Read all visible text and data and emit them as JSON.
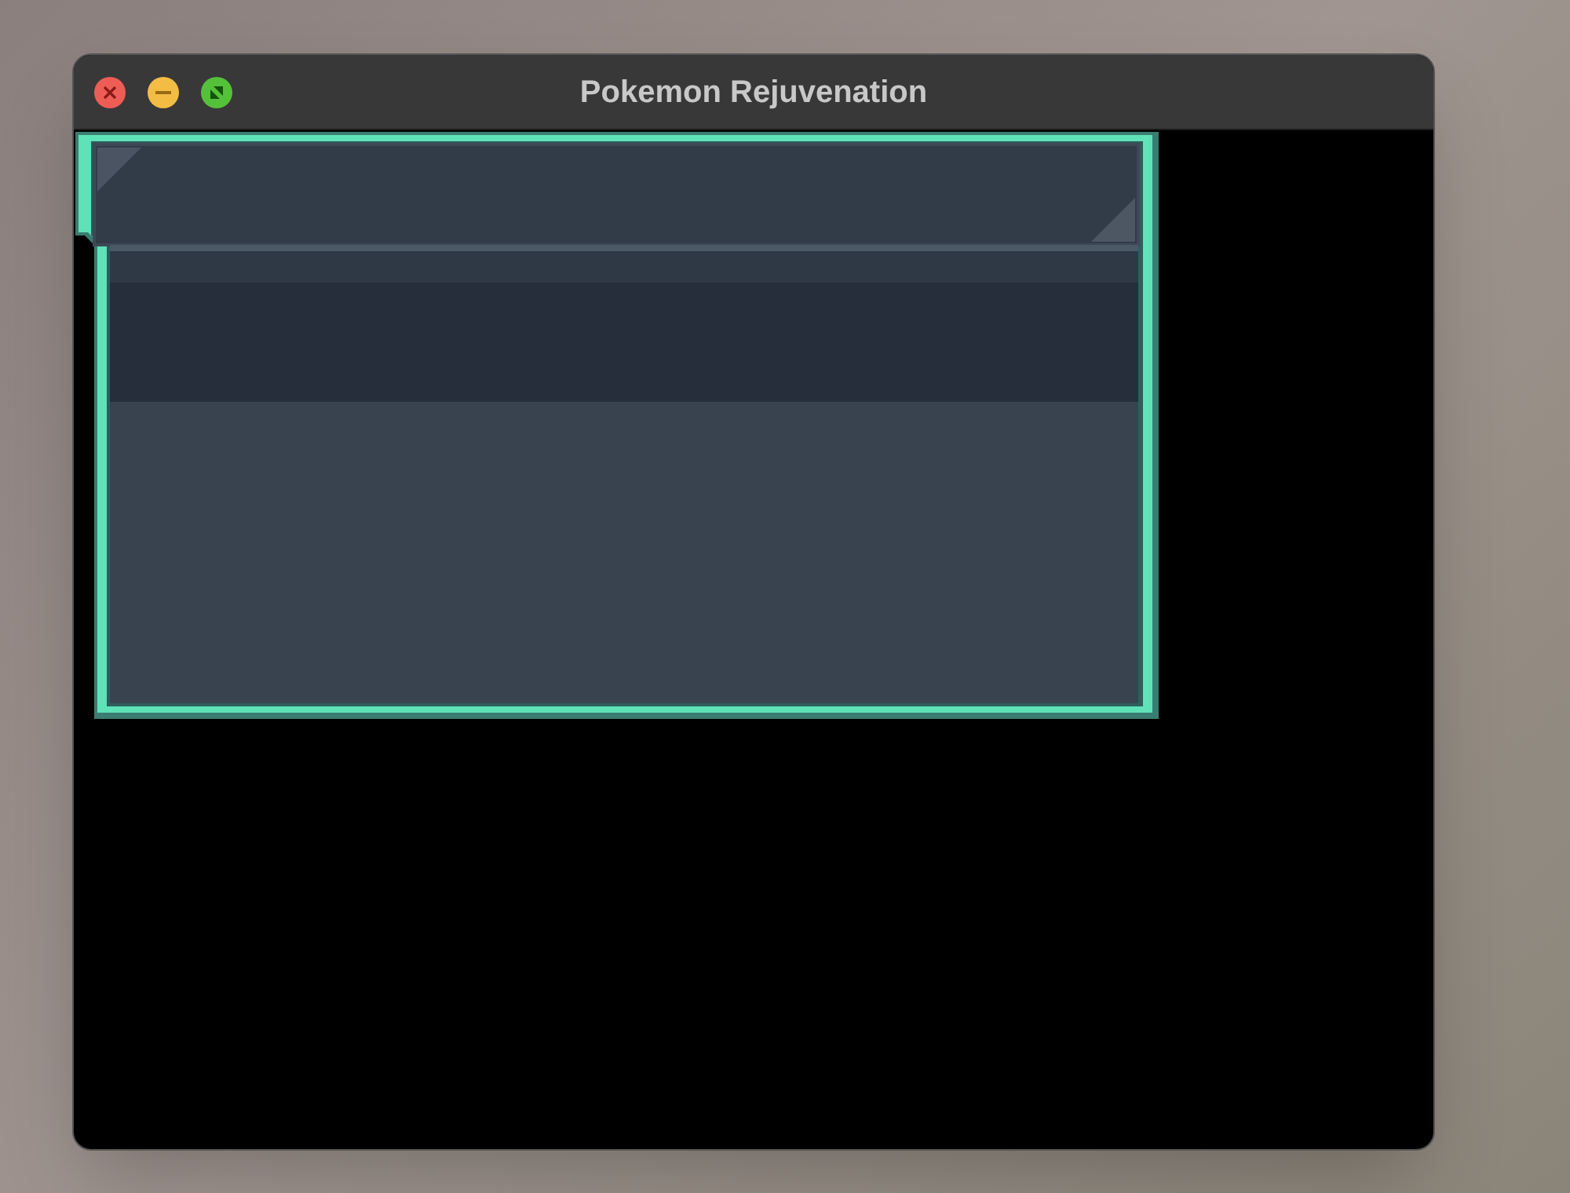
{
  "window": {
    "title": "Pokemon Rejuvenation"
  }
}
